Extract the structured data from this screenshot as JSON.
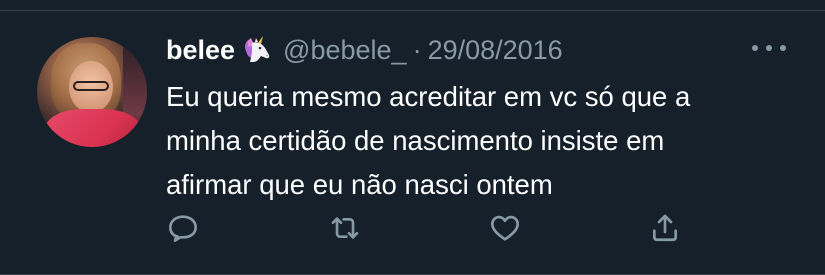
{
  "tweet": {
    "display_name": "belee",
    "name_emoji": "unicorn-emoji",
    "handle": "@bebele_",
    "separator": "·",
    "date": "29/08/2016",
    "text": "Eu queria mesmo acreditar em vc só que a\nminha certidão de nascimento insiste em\nafirmar que eu não nasci ontem"
  },
  "actions": [
    {
      "name": "reply",
      "icon": "reply-icon"
    },
    {
      "name": "retweet",
      "icon": "retweet-icon"
    },
    {
      "name": "like",
      "icon": "heart-icon"
    },
    {
      "name": "share",
      "icon": "share-icon"
    }
  ],
  "colors": {
    "background": "#15202b",
    "primary_text": "#ffffff",
    "secondary_text": "#8899a6",
    "divider": "#38444d"
  }
}
